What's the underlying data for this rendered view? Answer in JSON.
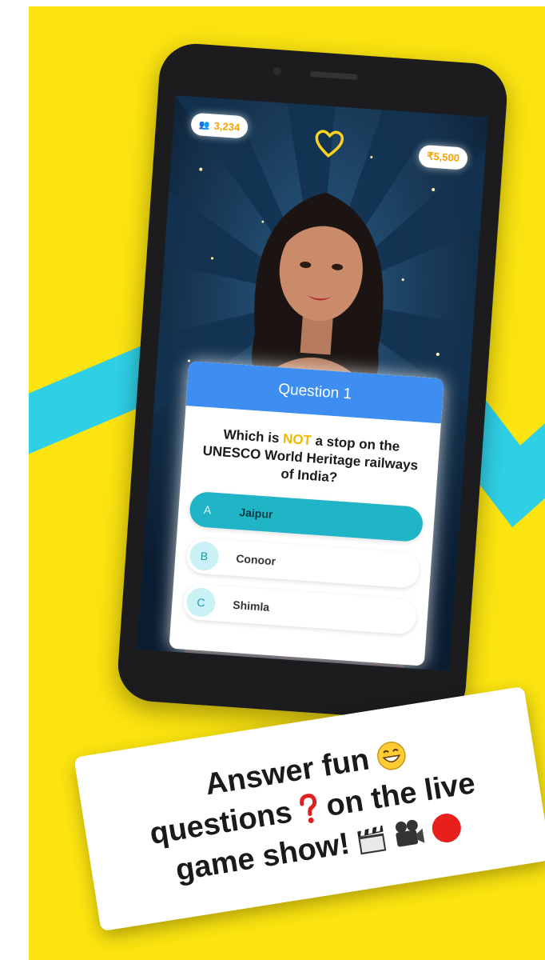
{
  "game": {
    "viewers": "3,234",
    "prize": "₹5,500",
    "question_title": "Question 1",
    "question_text_before": "Which is",
    "question_text_highlight": "NOT",
    "question_text_after": "a stop on the UNESCO World Heritage railways of India?",
    "options": [
      {
        "letter": "A",
        "label": "Jaipur",
        "selected": true
      },
      {
        "letter": "B",
        "label": "Conoor",
        "selected": false
      },
      {
        "letter": "C",
        "label": "Shimla",
        "selected": false
      }
    ]
  },
  "caption": {
    "line1": "Answer fun",
    "line2_a": "questions",
    "line2_b": "on the live",
    "line3": "game show!"
  },
  "colors": {
    "background_yellow": "#fbe410",
    "accent_cyan": "#1fb5c7",
    "header_blue": "#3d8ef0",
    "highlight_gold": "#f5b800"
  }
}
